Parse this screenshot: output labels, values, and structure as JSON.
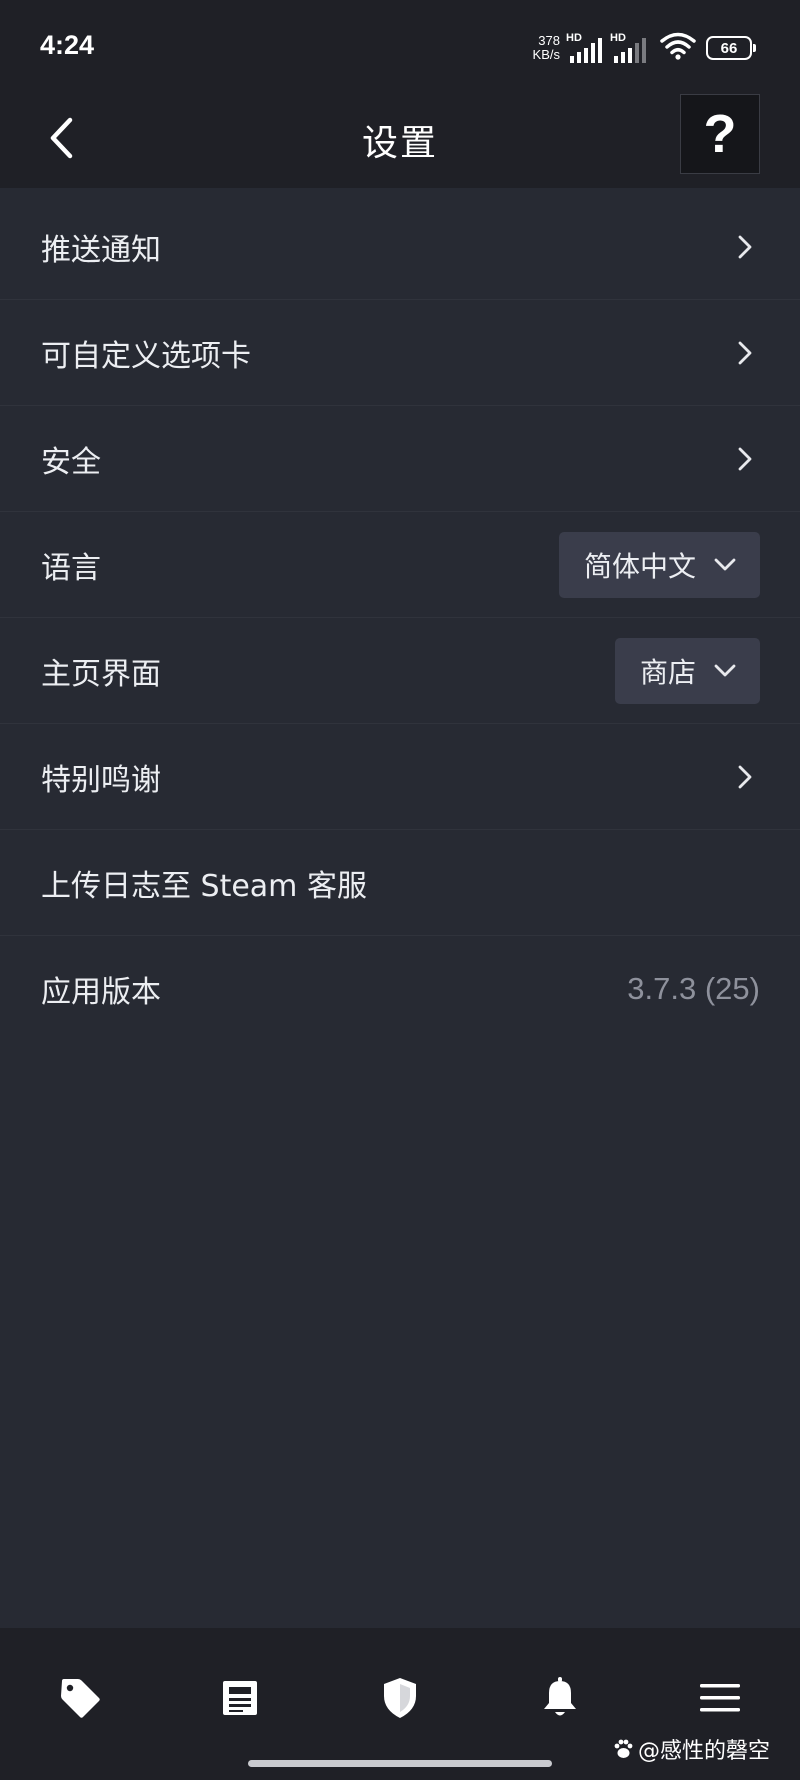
{
  "status_bar": {
    "time": "4:24",
    "net_speed_value": "378",
    "net_speed_unit": "KB/s",
    "sim1_label": "HD",
    "sim2_label": "HD",
    "battery": "66"
  },
  "header": {
    "title": "设置",
    "help_label": "?"
  },
  "settings": {
    "push_notifications": "推送通知",
    "custom_tabs": "可自定义选项卡",
    "security": "安全",
    "language_label": "语言",
    "language_value": "简体中文",
    "home_label": "主页界面",
    "home_value": "商店",
    "special_thanks": "特别鸣谢",
    "upload_logs": "上传日志至 Steam 客服",
    "app_version_label": "应用版本",
    "app_version_value": "3.7.3 (25)"
  },
  "bottom_nav": {
    "icons": [
      "tag-icon",
      "news-icon",
      "shield-icon",
      "bell-icon",
      "menu-icon"
    ]
  },
  "watermark": {
    "text": "@感性的磬空"
  },
  "colors": {
    "background": "#272a33",
    "bar": "#1f2026",
    "dropdown": "#3a3d4b",
    "muted_text": "#8e919c"
  }
}
